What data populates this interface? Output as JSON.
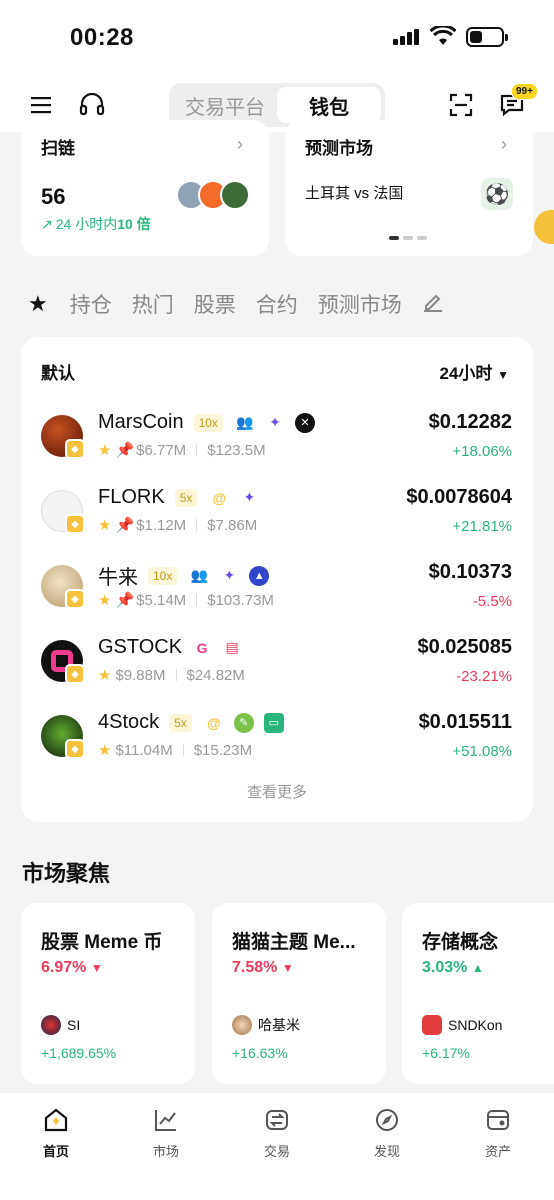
{
  "status": {
    "time": "00:28"
  },
  "header": {
    "seg_left": "交易平台",
    "seg_right": "钱包",
    "msg_badge": "99+"
  },
  "cards": {
    "scan": {
      "title": "扫链",
      "count": "56",
      "sub_prefix": "24 小时内",
      "sub_highlight": "10 倍"
    },
    "predict": {
      "title": "预测市场",
      "match": "土耳其 vs 法国"
    }
  },
  "tabs": [
    "持仓",
    "热门",
    "股票",
    "合约",
    "预测市场"
  ],
  "list": {
    "title": "默认",
    "timeframe": "24小时",
    "more": "查看更多",
    "rows": [
      {
        "name": "MarsCoin",
        "lev": "10x",
        "vol": "$6.77M",
        "mcap": "$123.5M",
        "price": "$0.12282",
        "change": "+18.06%",
        "dir": "up",
        "color": "#8a2a12"
      },
      {
        "name": "FLORK",
        "lev": "5x",
        "vol": "$1.12M",
        "mcap": "$7.86M",
        "price": "$0.0078604",
        "change": "+21.81%",
        "dir": "up",
        "color": "#f2f2f2"
      },
      {
        "name": "牛来",
        "lev": "10x",
        "vol": "$5.14M",
        "mcap": "$103.73M",
        "price": "$0.10373",
        "change": "-5.5%",
        "dir": "down",
        "color": "#e9d7b3"
      },
      {
        "name": "GSTOCK",
        "lev": "",
        "vol": "$9.88M",
        "mcap": "$24.82M",
        "price": "$0.025085",
        "change": "-23.21%",
        "dir": "down",
        "color": "#111111"
      },
      {
        "name": "4Stock",
        "lev": "5x",
        "vol": "$11.04M",
        "mcap": "$15.23M",
        "price": "$0.015511",
        "change": "+51.08%",
        "dir": "up",
        "color": "#1d2a16"
      }
    ]
  },
  "focus": {
    "title": "市场聚焦",
    "cards": [
      {
        "title": "股票 Meme 币",
        "pct": "6.97%",
        "dir": "down",
        "coin": "SI",
        "coin_change": "+1,689.65%"
      },
      {
        "title": "猫猫主题 Me...",
        "pct": "7.58%",
        "dir": "down",
        "coin": "哈基米",
        "coin_change": "+16.63%"
      },
      {
        "title": "存储概念",
        "pct": "3.03%",
        "dir": "up",
        "coin": "SNDKon",
        "coin_change": "+6.17%"
      }
    ]
  },
  "nav": [
    {
      "label": "首页",
      "icon": "home-icon"
    },
    {
      "label": "市场",
      "icon": "chart-icon"
    },
    {
      "label": "交易",
      "icon": "swap-icon"
    },
    {
      "label": "发现",
      "icon": "compass-icon"
    },
    {
      "label": "资产",
      "icon": "wallet-icon"
    }
  ]
}
